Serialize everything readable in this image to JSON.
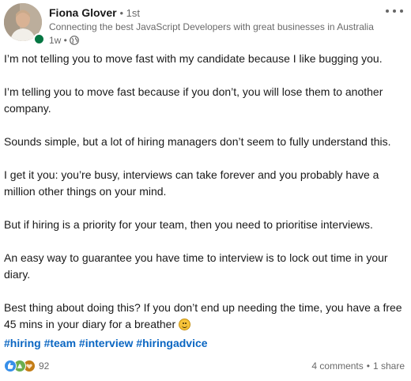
{
  "author": {
    "name": "Fiona Glover",
    "degree": "• 1st",
    "headline": "Connecting the best JavaScript Developers with great businesses in Australia",
    "time": "1w •",
    "online_color": "#057642"
  },
  "post": {
    "paragraphs": [
      "I’m not telling you to move fast with my candidate because I like bugging you.",
      "I’m telling you to move fast because if you don’t, you will lose them to another company.",
      "Sounds simple, but a lot of hiring managers don’t seem to fully understand this.",
      "I get it you: you’re busy, interviews can take forever and you probably have a million other things on your mind.",
      "But if hiring is a priority for your team, then you need to prioritise interviews.",
      "An easy way to guarantee you have time to interview is to lock out time in your diary.",
      "Best thing about doing this? If you don’t end up needing the time, you have a free 45 mins in your diary for a breather"
    ],
    "hashtags": [
      "#hiring",
      "#team",
      "#interview",
      "#hiringadvice"
    ],
    "link_color": "#0a66c2"
  },
  "social": {
    "reactions_count": "92",
    "reaction_icons": [
      "like-icon",
      "celebrate-icon",
      "support-icon"
    ],
    "comments": "4 comments",
    "separator": "•",
    "shares": "1 share"
  }
}
